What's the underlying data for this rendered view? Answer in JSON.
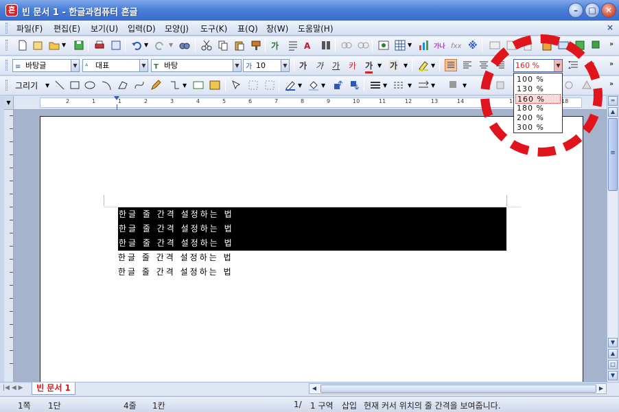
{
  "window": {
    "title": "빈 문서 1 - 한글과컴퓨터 흔글",
    "app_icon": "흔"
  },
  "menubar": {
    "items": [
      "파일(F)",
      "편집(E)",
      "보기(U)",
      "입력(D)",
      "모양(J)",
      "도구(K)",
      "표(Q)",
      "창(W)",
      "도움말(H)"
    ],
    "close": "×"
  },
  "format_toolbar": {
    "style_combo": "바탕글",
    "outline_combo": "대표",
    "font_combo": "바탕",
    "size_combo": "10",
    "buttons": [
      "가",
      "가",
      "가",
      "카",
      "가",
      "가"
    ],
    "line_spacing_value": "160 %"
  },
  "draw_toolbar": {
    "draw_label": "그리기"
  },
  "line_spacing_dropdown": {
    "options": [
      "100 %",
      "130 %",
      "160 %",
      "180 %",
      "200 %",
      "300 %"
    ],
    "selected": "160 %"
  },
  "ruler": {
    "labels": [
      "2",
      "1",
      "1",
      "2",
      "3",
      "4",
      "5",
      "6",
      "7",
      "8",
      "9",
      "10",
      "11",
      "12",
      "13",
      "14",
      "15",
      "16",
      "17",
      "18"
    ]
  },
  "document": {
    "lines": [
      "한글 줄 간격 설정하는 법",
      "한글 줄 간격 설정하는 법",
      "한글 줄 간격 설정하는 법",
      "한글 줄 간격 설정하는 법",
      "한글 줄 간격 설정하는 법"
    ],
    "selected_line_count": 3
  },
  "tabs": {
    "active": "빈 문서 1"
  },
  "statusbar": {
    "page": "1쪽",
    "column": "1단",
    "line": "4줄",
    "col": "1칸",
    "page_count": "1/",
    "section": "1 구역",
    "mode": "삽입",
    "message": "현재 커서 위치의 줄 간격을 보여줍니다."
  },
  "annotation": {
    "color": "#e0141c"
  }
}
